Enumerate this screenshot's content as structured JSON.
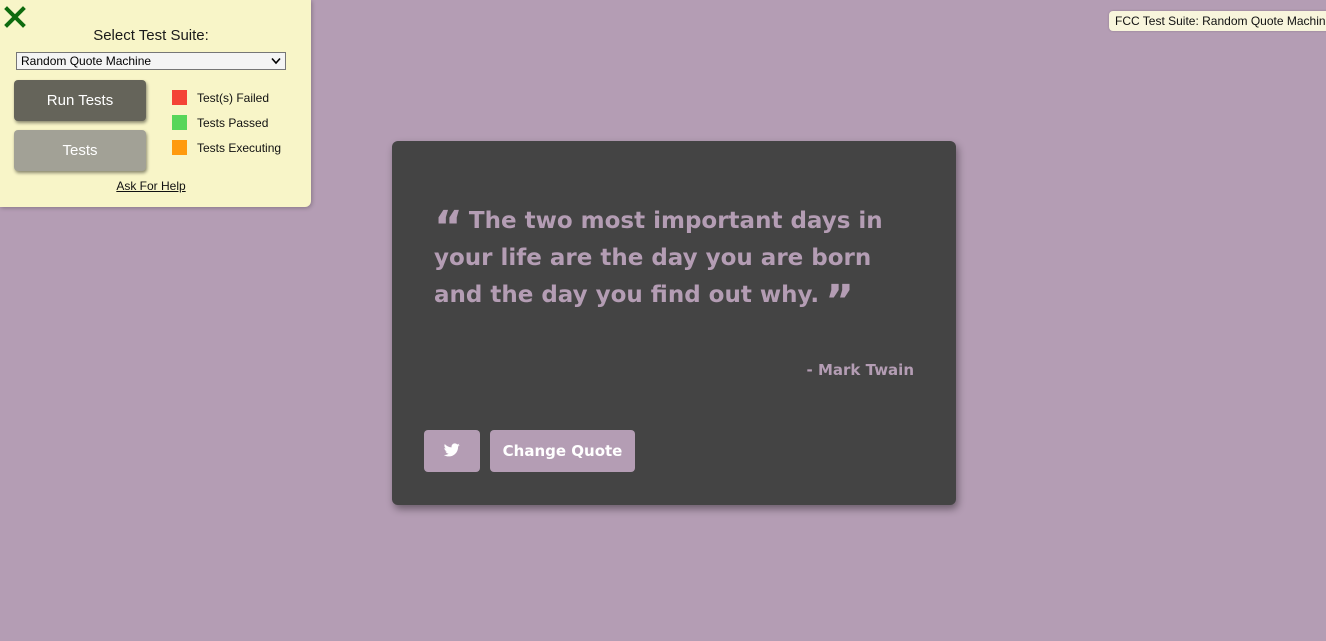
{
  "fcc_panel": {
    "select_label": "Select Test Suite:",
    "selected_suite": "Random Quote Machine",
    "run_tests_label": "Run Tests",
    "tests_label": "Tests",
    "legend": [
      {
        "label": "Test(s) Failed",
        "color": "#f44336"
      },
      {
        "label": "Tests Passed",
        "color": "#58d65a"
      },
      {
        "label": "Tests Executing",
        "color": "#ff9a0e"
      }
    ],
    "help_label": "Ask For Help",
    "tag_text": "FCC Test Suite: Random Quote Machine"
  },
  "quote": {
    "text": "The two most important days in your life are the day you are born and the day you find out why.",
    "author": "- Mark Twain",
    "change_label": "Change Quote"
  },
  "colors": {
    "background": "#b49db4",
    "card": "#444444",
    "accent": "#b49db4",
    "panel": "#f8f5c8"
  }
}
